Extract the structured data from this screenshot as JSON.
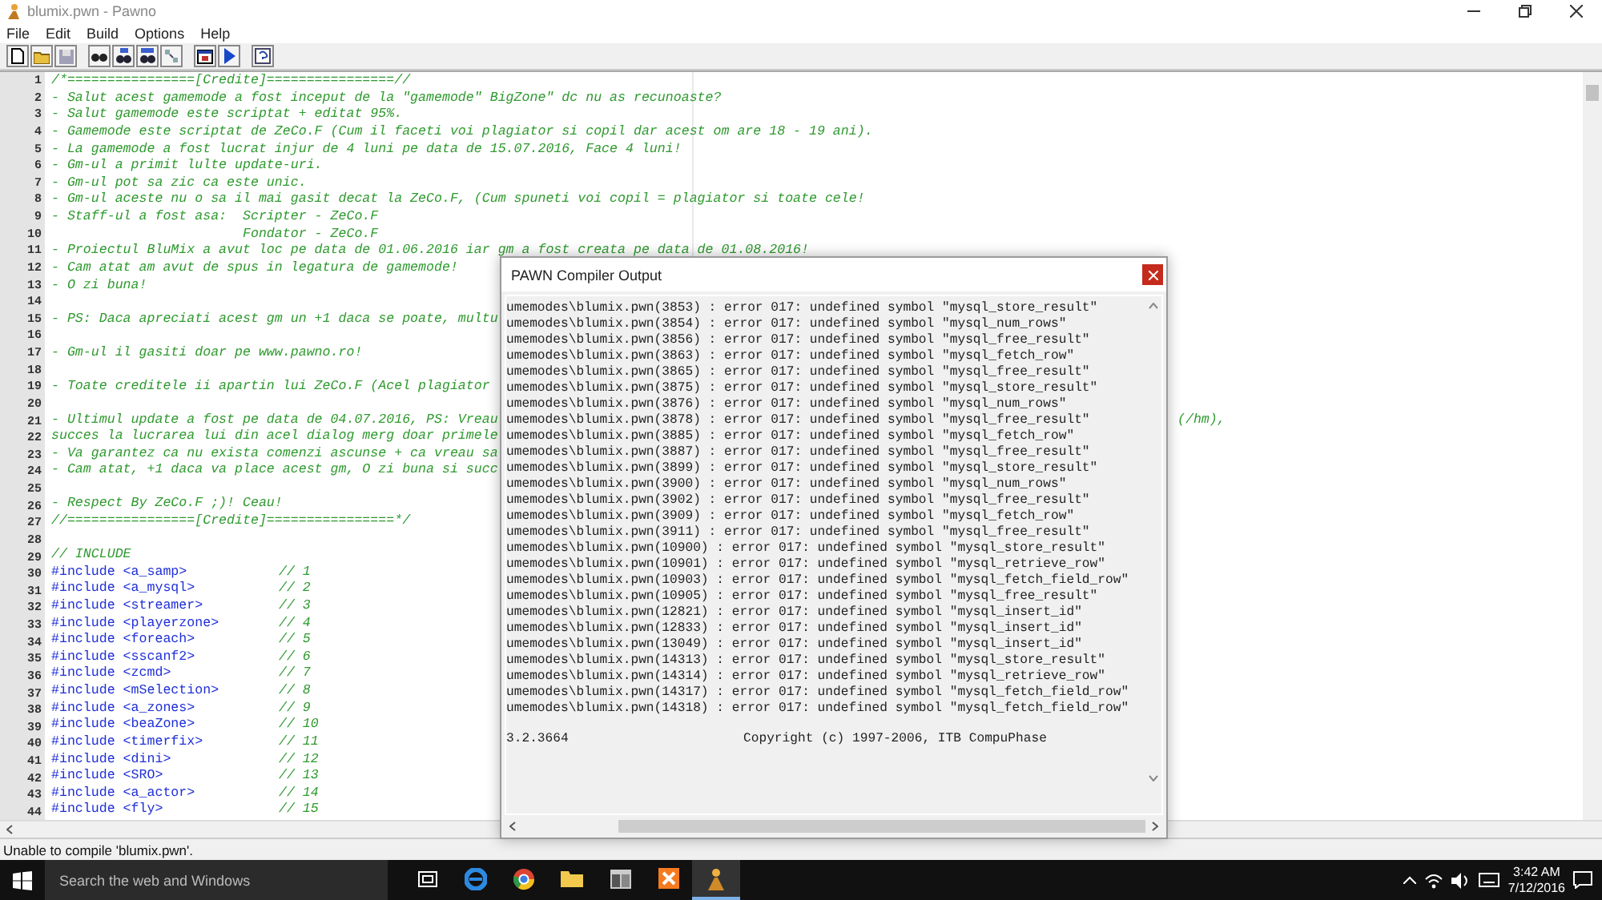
{
  "window": {
    "title": "blumix.pwn - Pawno"
  },
  "menu": [
    "File",
    "Edit",
    "Build",
    "Options",
    "Help"
  ],
  "editor": {
    "lines": [
      {
        "number": "1",
        "kind": "comment",
        "text": "/*================[Credite]================//"
      },
      {
        "number": "2",
        "kind": "comment",
        "text": "- Salut acest gamemode a fost inceput de la \"gamemode\" BigZone\" dc nu as recunoaste?"
      },
      {
        "number": "3",
        "kind": "comment",
        "text": "- Salut gamemode este scriptat + editat 95%."
      },
      {
        "number": "4",
        "kind": "comment",
        "text": "- Gamemode este scriptat de ZeCo.F (Cum il faceti voi plagiator si copil dar acest om are 18 - 19 ani)."
      },
      {
        "number": "5",
        "kind": "comment",
        "text": "- La gamemode a fost lucrat injur de 4 luni pe data de 15.07.2016, Face 4 luni!"
      },
      {
        "number": "6",
        "kind": "comment",
        "text": "- Gm-ul a primit lulte update-uri."
      },
      {
        "number": "7",
        "kind": "comment",
        "text": "- Gm-ul pot sa zic ca este unic."
      },
      {
        "number": "8",
        "kind": "comment",
        "text": "- Gm-ul aceste nu o sa il mai gasit decat la ZeCo.F, (Cum spuneti voi copil = plagiator si toate cele!"
      },
      {
        "number": "9",
        "kind": "comment",
        "text": "- Staff-ul a fost asa:  Scripter - ZeCo.F"
      },
      {
        "number": "10",
        "kind": "comment",
        "text": "                        Fondator - ZeCo.F"
      },
      {
        "number": "11",
        "kind": "comment",
        "text": "- Proiectul BluMix a avut loc pe data de 01.06.2016 iar gm a fost creata pe data de 01.08.2016!"
      },
      {
        "number": "12",
        "kind": "comment",
        "text": "- Cam atat am avut de spus in legatura de gamemode!"
      },
      {
        "number": "13",
        "kind": "comment",
        "text": "- O zi buna!"
      },
      {
        "number": "14",
        "kind": "blank"
      },
      {
        "number": "15",
        "kind": "comment",
        "text": "- PS: Daca apreciati acest gm un +1 daca se poate, multu"
      },
      {
        "number": "16",
        "kind": "blank"
      },
      {
        "number": "17",
        "kind": "comment",
        "text": "- Gm-ul il gasiti doar pe www.pawno.ro!"
      },
      {
        "number": "18",
        "kind": "blank"
      },
      {
        "number": "19",
        "kind": "comment",
        "text": "- Toate creditele ii apartin lui ZeCo.F (Acel plagiator"
      },
      {
        "number": "20",
        "kind": "blank"
      },
      {
        "number": "21",
        "kind": "comment",
        "text": "- Ultimul update a fost pe data de 04.07.2016, PS: Vreau",
        "tail": "(/hm),"
      },
      {
        "number": "22",
        "kind": "comment",
        "text": "succes la lucrarea lui din acel dialog merg doar primele"
      },
      {
        "number": "23",
        "kind": "comment",
        "text": "- Va garantez ca nu exista comenzi ascunse + ca vreau sa"
      },
      {
        "number": "24",
        "kind": "comment",
        "text": "- Cam atat, +1 daca va place acest gm, O zi buna si succ"
      },
      {
        "number": "25",
        "kind": "blank"
      },
      {
        "number": "26",
        "kind": "comment",
        "text": "- Respect By ZeCo.F ;)! Ceau!"
      },
      {
        "number": "27",
        "kind": "comment",
        "text": "//================[Credite]================*/"
      },
      {
        "number": "28",
        "kind": "blank"
      },
      {
        "number": "29",
        "kind": "comment",
        "text": "// INCLUDE"
      },
      {
        "number": "30",
        "kind": "include",
        "text": "#include <a_samp>",
        "comment": "// 1"
      },
      {
        "number": "31",
        "kind": "include",
        "text": "#include <a_mysql>",
        "comment": "// 2"
      },
      {
        "number": "32",
        "kind": "include",
        "text": "#include <streamer>",
        "comment": "// 3"
      },
      {
        "number": "33",
        "kind": "include",
        "text": "#include <playerzone>",
        "comment": "// 4"
      },
      {
        "number": "34",
        "kind": "include",
        "text": "#include <foreach>",
        "comment": "// 5"
      },
      {
        "number": "35",
        "kind": "include",
        "text": "#include <sscanf2>",
        "comment": "// 6"
      },
      {
        "number": "36",
        "kind": "include",
        "text": "#include <zcmd>",
        "comment": "// 7"
      },
      {
        "number": "37",
        "kind": "include",
        "text": "#include <mSelection>",
        "comment": "// 8"
      },
      {
        "number": "38",
        "kind": "include",
        "text": "#include <a_zones>",
        "comment": "// 9"
      },
      {
        "number": "39",
        "kind": "include",
        "text": "#include <beaZone>",
        "comment": "// 10"
      },
      {
        "number": "40",
        "kind": "include",
        "text": "#include <timerfix>",
        "comment": "// 11"
      },
      {
        "number": "41",
        "kind": "include",
        "text": "#include <dini>",
        "comment": "// 12"
      },
      {
        "number": "42",
        "kind": "include",
        "text": "#include <SRO>",
        "comment": "// 13"
      },
      {
        "number": "43",
        "kind": "include",
        "text": "#include <a_actor>",
        "comment": "// 14"
      },
      {
        "number": "44",
        "kind": "include",
        "text": "#include <fly>",
        "comment": "// 15"
      }
    ]
  },
  "dialog": {
    "title": "PAWN Compiler Output",
    "lines": [
      "umemodes\\blumix.pwn(3853) : error 017: undefined symbol \"mysql_store_result\"",
      "umemodes\\blumix.pwn(3854) : error 017: undefined symbol \"mysql_num_rows\"",
      "umemodes\\blumix.pwn(3856) : error 017: undefined symbol \"mysql_free_result\"",
      "umemodes\\blumix.pwn(3863) : error 017: undefined symbol \"mysql_fetch_row\"",
      "umemodes\\blumix.pwn(3865) : error 017: undefined symbol \"mysql_free_result\"",
      "umemodes\\blumix.pwn(3875) : error 017: undefined symbol \"mysql_store_result\"",
      "umemodes\\blumix.pwn(3876) : error 017: undefined symbol \"mysql_num_rows\"",
      "umemodes\\blumix.pwn(3878) : error 017: undefined symbol \"mysql_free_result\"",
      "umemodes\\blumix.pwn(3885) : error 017: undefined symbol \"mysql_fetch_row\"",
      "umemodes\\blumix.pwn(3887) : error 017: undefined symbol \"mysql_free_result\"",
      "umemodes\\blumix.pwn(3899) : error 017: undefined symbol \"mysql_store_result\"",
      "umemodes\\blumix.pwn(3900) : error 017: undefined symbol \"mysql_num_rows\"",
      "umemodes\\blumix.pwn(3902) : error 017: undefined symbol \"mysql_free_result\"",
      "umemodes\\blumix.pwn(3909) : error 017: undefined symbol \"mysql_fetch_row\"",
      "umemodes\\blumix.pwn(3911) : error 017: undefined symbol \"mysql_free_result\"",
      "umemodes\\blumix.pwn(10900) : error 017: undefined symbol \"mysql_store_result\"",
      "umemodes\\blumix.pwn(10901) : error 017: undefined symbol \"mysql_retrieve_row\"",
      "umemodes\\blumix.pwn(10903) : error 017: undefined symbol \"mysql_fetch_field_row\"",
      "umemodes\\blumix.pwn(10905) : error 017: undefined symbol \"mysql_free_result\"",
      "umemodes\\blumix.pwn(12821) : error 017: undefined symbol \"mysql_insert_id\"",
      "umemodes\\blumix.pwn(12833) : error 017: undefined symbol \"mysql_insert_id\"",
      "umemodes\\blumix.pwn(13049) : error 017: undefined symbol \"mysql_insert_id\"",
      "umemodes\\blumix.pwn(14313) : error 017: undefined symbol \"mysql_store_result\"",
      "umemodes\\blumix.pwn(14314) : error 017: undefined symbol \"mysql_retrieve_row\"",
      "umemodes\\blumix.pwn(14317) : error 017: undefined symbol \"mysql_fetch_field_row\"",
      "umemodes\\blumix.pwn(14318) : error 017: undefined symbol \"mysql_fetch_field_row\""
    ],
    "version": "3.2.3664",
    "copyright": "Copyright (c) 1997-2006, ITB CompuPhase"
  },
  "status_bar": "Unable to compile 'blumix.pwn'.",
  "taskbar": {
    "search_placeholder": "Search the web and Windows",
    "time": "3:42 AM",
    "date": "7/12/2016"
  }
}
